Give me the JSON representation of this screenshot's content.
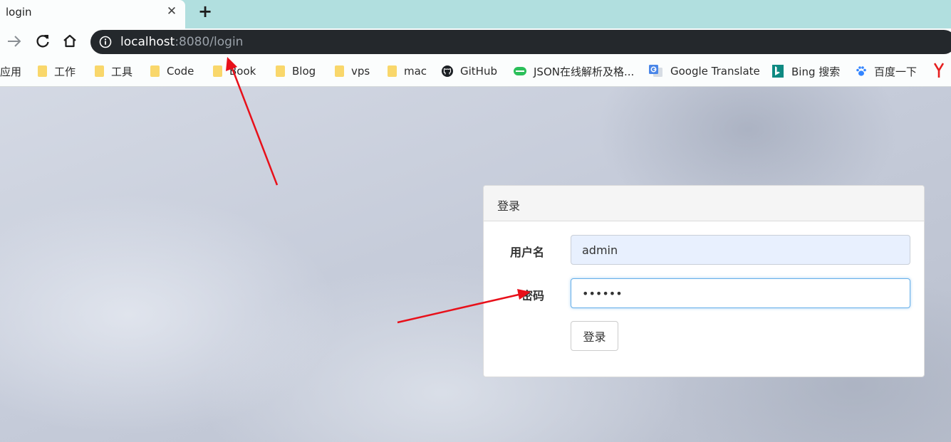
{
  "tab": {
    "title": "login",
    "close_glyph": "✕",
    "new_tab_glyph": "+"
  },
  "address_bar": {
    "host": "localhost",
    "rest": ":8080/login"
  },
  "bookmarks": [
    {
      "label": "应用",
      "icon": "apps-icon"
    },
    {
      "label": "工作",
      "icon": "folder-icon"
    },
    {
      "label": "工具",
      "icon": "folder-icon"
    },
    {
      "label": "Code",
      "icon": "folder-icon"
    },
    {
      "label": "Book",
      "icon": "folder-icon"
    },
    {
      "label": "Blog",
      "icon": "folder-icon"
    },
    {
      "label": "vps",
      "icon": "folder-icon"
    },
    {
      "label": "mac",
      "icon": "folder-icon"
    },
    {
      "label": "GitHub",
      "icon": "github-icon"
    },
    {
      "label": "JSON在线解析及格...",
      "icon": "json-icon"
    },
    {
      "label": "Google Translate",
      "icon": "google-translate-icon"
    },
    {
      "label": "Bing 搜索",
      "icon": "bing-icon"
    },
    {
      "label": "百度一下",
      "icon": "baidu-icon"
    }
  ],
  "login_panel": {
    "heading": "登录",
    "username_label": "用户名",
    "username_value": "admin",
    "password_label": "密码",
    "password_value": "••••••",
    "submit_label": "登录"
  },
  "colors": {
    "tabstrip": "#b1dfdf",
    "omnibox": "#24282c",
    "annotation_arrow": "#e8101a",
    "focus_border": "#66afe9"
  }
}
